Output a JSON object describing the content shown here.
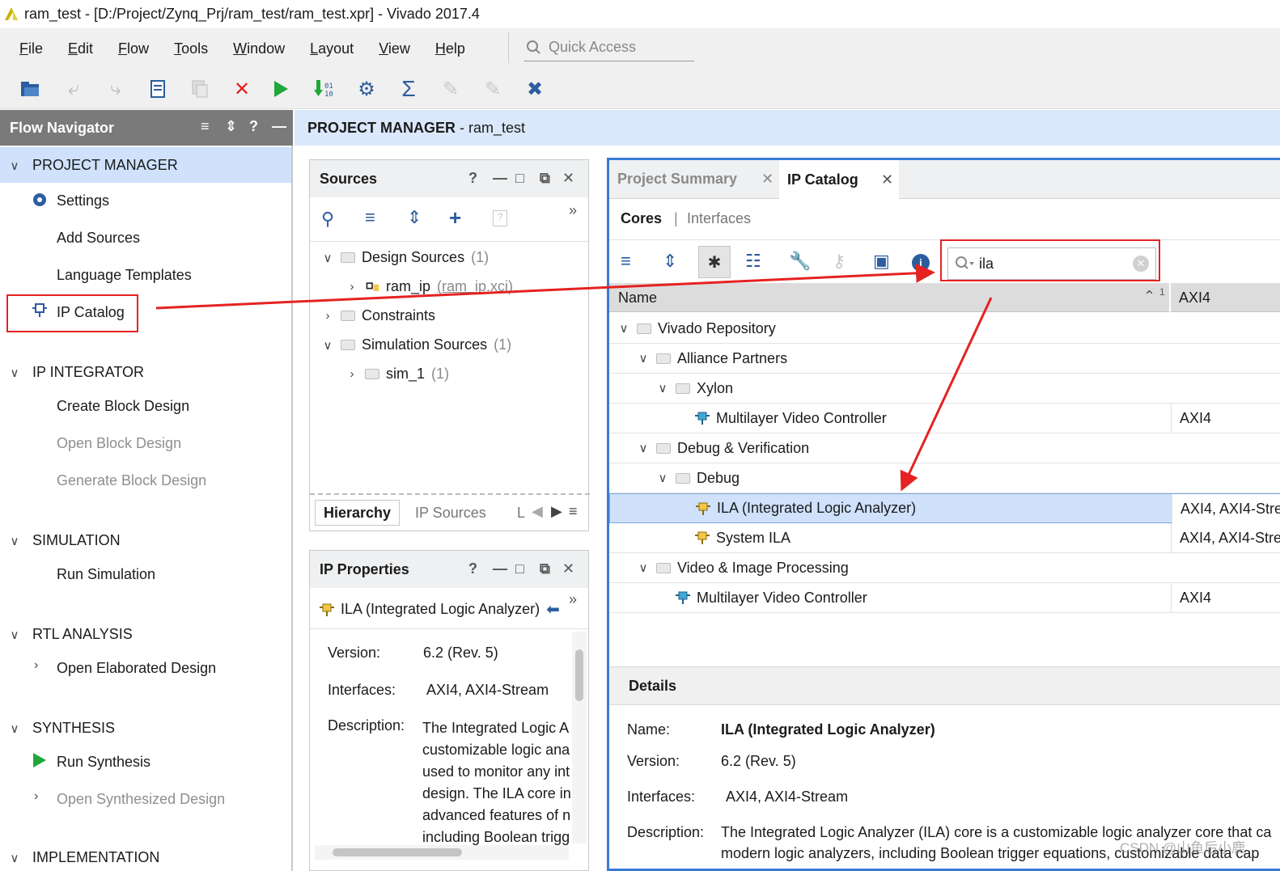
{
  "window": {
    "title": "ram_test - [D:/Project/Zynq_Prj/ram_test/ram_test.xpr] - Vivado 2017.4"
  },
  "menu": [
    "File",
    "Edit",
    "Flow",
    "Tools",
    "Window",
    "Layout",
    "View",
    "Help"
  ],
  "quick_access": {
    "placeholder": "Quick Access"
  },
  "toolbar_icons": [
    "open-project-icon",
    "undo-icon",
    "redo-icon",
    "report-icon",
    "copy-icon",
    "cancel-icon",
    "run-icon",
    "generate-bitstream-icon",
    "settings-icon",
    "sigma-icon",
    "disabled-tool-icon",
    "disabled-tool-icon-2",
    "debug-icon"
  ],
  "flow_navigator": {
    "title": "Flow Navigator",
    "sections": {
      "project_manager": {
        "label": "PROJECT MANAGER",
        "items": [
          "Settings",
          "Add Sources",
          "Language Templates",
          "IP Catalog"
        ]
      },
      "ip_integrator": {
        "label": "IP INTEGRATOR",
        "items": [
          "Create Block Design",
          "Open Block Design",
          "Generate Block Design"
        ]
      },
      "simulation": {
        "label": "SIMULATION",
        "items": [
          "Run Simulation"
        ]
      },
      "rtl_analysis": {
        "label": "RTL ANALYSIS",
        "items": [
          "Open Elaborated Design"
        ]
      },
      "synthesis": {
        "label": "SYNTHESIS",
        "items": [
          "Run Synthesis",
          "Open Synthesized Design"
        ]
      },
      "implementation": {
        "label": "IMPLEMENTATION"
      }
    }
  },
  "project_manager": {
    "label": "PROJECT MANAGER",
    "project": "- ram_test"
  },
  "sources": {
    "title": "Sources",
    "tree": {
      "design_sources": {
        "label": "Design Sources",
        "count": "(1)"
      },
      "ram_ip": {
        "label": "ram_ip",
        "file": "(ram_ip.xci)"
      },
      "constraints": {
        "label": "Constraints"
      },
      "simulation_sources": {
        "label": "Simulation Sources",
        "count": "(1)"
      },
      "sim_1": {
        "label": "sim_1",
        "count": "(1)"
      }
    },
    "tabs": {
      "hierarchy": "Hierarchy",
      "ip_sources": "IP Sources",
      "libraries": "L"
    }
  },
  "ip_properties": {
    "title": "IP Properties",
    "selected": "ILA (Integrated Logic Analyzer)",
    "version_label": "Version:",
    "version": "6.2 (Rev. 5)",
    "interfaces_label": "Interfaces:",
    "interfaces": "AXI4, AXI4-Stream",
    "description_label": "Description:",
    "description_lines": [
      "The Integrated Logic A",
      "customizable logic ana",
      "used to monitor any int",
      "design. The ILA core in",
      "advanced features of n",
      "including Boolean trigg"
    ]
  },
  "ip_catalog": {
    "tabs": {
      "project_summary": "Project Summary",
      "ip_catalog": "IP Catalog"
    },
    "subtabs": {
      "cores": "Cores",
      "separator": "|",
      "interfaces": "Interfaces"
    },
    "search": {
      "value": "ila"
    },
    "columns": {
      "name": "Name",
      "sort_index": "1",
      "axi": "AXI4"
    },
    "rows": {
      "vivado_repo": {
        "label": "Vivado Repository"
      },
      "alliance": {
        "label": "Alliance Partners"
      },
      "xylon": {
        "label": "Xylon"
      },
      "mvc1": {
        "label": "Multilayer Video Controller",
        "axi": "AXI4"
      },
      "debug_verif": {
        "label": "Debug & Verification"
      },
      "debug": {
        "label": "Debug"
      },
      "ila": {
        "label": "ILA (Integrated Logic Analyzer)",
        "axi": "AXI4, AXI4-Stre"
      },
      "system_ila": {
        "label": "System ILA",
        "axi": "AXI4, AXI4-Stre"
      },
      "video": {
        "label": "Video & Image Processing"
      },
      "mvc2": {
        "label": "Multilayer Video Controller",
        "axi": "AXI4"
      }
    },
    "details": {
      "title": "Details",
      "name_label": "Name:",
      "name": "ILA (Integrated Logic Analyzer)",
      "version_label": "Version:",
      "version": "6.2 (Rev. 5)",
      "interfaces_label": "Interfaces:",
      "interfaces": "AXI4, AXI4-Stream",
      "description_label": "Description:",
      "description_line1": "The Integrated Logic Analyzer (ILA) core is a customizable logic analyzer core that ca",
      "description_line2": "modern logic analyzers, including Boolean trigger equations, customizable data cap"
    }
  },
  "watermark": "CSDN @山鱼后小鹿",
  "colors": {
    "annotation_red": "#e52222",
    "accent_blue": "#3a7bd5",
    "selected_row": "#cfe1fb",
    "nav_header": "#7a7a7a"
  }
}
